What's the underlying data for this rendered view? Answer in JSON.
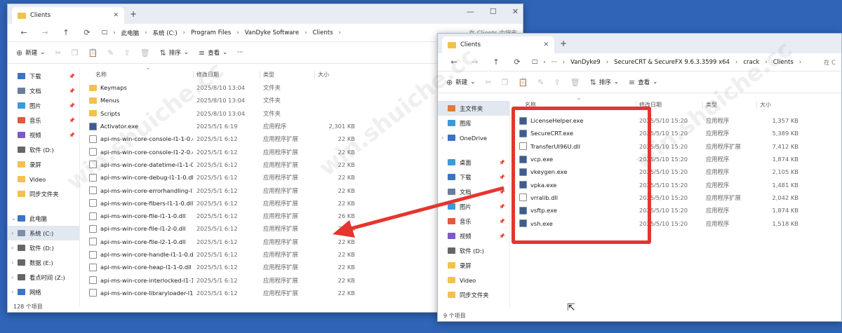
{
  "watermark": "win.shuiche.cc",
  "colors": {
    "accent": "#2f64b7",
    "highlight": "#e5352e",
    "folder": "#f2c14e"
  },
  "win_a": {
    "tab_title": "Clients",
    "nav": [
      "←",
      "→",
      "↑",
      "⟳"
    ],
    "breadcrumb": [
      "此电脑",
      "系统 (C:)",
      "Program Files",
      "VanDyke Software",
      "Clients"
    ],
    "search": "在 Clients 中搜索",
    "toolbar": {
      "new": "新建",
      "sort": "排序",
      "view": "查看",
      "more": "···"
    },
    "sidebar": [
      {
        "label": "下载",
        "color": "#3b73c5",
        "pin": true
      },
      {
        "label": "文档",
        "color": "#6b7f9c",
        "pin": true
      },
      {
        "label": "图片",
        "color": "#3b9ad8",
        "pin": true
      },
      {
        "label": "音乐",
        "color": "#e25a3c",
        "pin": true
      },
      {
        "label": "视频",
        "color": "#7b5bc7",
        "pin": true
      },
      {
        "label": "软件 (D:)",
        "color": "#666666",
        "pin": false
      },
      {
        "label": "录屏",
        "color": "#f2c14e",
        "pin": false
      },
      {
        "label": "Video",
        "color": "#f2c14e",
        "pin": false
      },
      {
        "label": "同步文件夹",
        "color": "#f2c14e",
        "pin": false
      },
      {
        "label": "",
        "color": "",
        "pin": false
      },
      {
        "label": "此电脑",
        "color": "#3b73c5",
        "pin": false,
        "chev": "⌄"
      },
      {
        "label": "系统 (C:)",
        "color": "#7d8ea8",
        "pin": false,
        "chev": "›",
        "sel": true
      },
      {
        "label": "软件 (D:)",
        "color": "#666666",
        "pin": false,
        "chev": "›"
      },
      {
        "label": "数据 (E:)",
        "color": "#666666",
        "pin": false,
        "chev": "›"
      },
      {
        "label": "看点时间 (Z:)",
        "color": "#666666",
        "pin": false,
        "chev": "›"
      },
      {
        "label": "网络",
        "color": "#3b73c5",
        "pin": false,
        "chev": "›"
      }
    ],
    "headers": [
      "名称",
      "修改日期",
      "类型",
      "大小"
    ],
    "rows": [
      {
        "icon": "folder",
        "name": "Keymaps",
        "date": "2025/8/10 13:04",
        "type": "文件夹",
        "size": ""
      },
      {
        "icon": "folder",
        "name": "Menus",
        "date": "2025/8/10 13:04",
        "type": "文件夹",
        "size": ""
      },
      {
        "icon": "folder",
        "name": "Scripts",
        "date": "2025/8/10 13:04",
        "type": "文件夹",
        "size": ""
      },
      {
        "icon": "exe",
        "name": "Activator.exe",
        "date": "2025/5/1 6:19",
        "type": "应用程序",
        "size": "2,301 KB"
      },
      {
        "icon": "dll",
        "name": "api-ms-win-core-console-l1-1-0.dll",
        "date": "2025/5/1 6:12",
        "type": "应用程序扩展",
        "size": "22 KB"
      },
      {
        "icon": "dll",
        "name": "api-ms-win-core-console-l1-2-0.dll",
        "date": "2025/5/1 6:12",
        "type": "应用程序扩展",
        "size": "22 KB"
      },
      {
        "icon": "dll",
        "name": "api-ms-win-core-datetime-l1-1-0.dll",
        "date": "2025/5/1 6:12",
        "type": "应用程序扩展",
        "size": "22 KB"
      },
      {
        "icon": "dll",
        "name": "api-ms-win-core-debug-l1-1-0.dll",
        "date": "2025/5/1 6:12",
        "type": "应用程序扩展",
        "size": "22 KB"
      },
      {
        "icon": "dll",
        "name": "api-ms-win-core-errorhandling-l1-1-...",
        "date": "2025/5/1 6:12",
        "type": "应用程序扩展",
        "size": "22 KB"
      },
      {
        "icon": "dll",
        "name": "api-ms-win-core-fibers-l1-1-0.dll",
        "date": "2025/5/1 6:12",
        "type": "应用程序扩展",
        "size": "22 KB"
      },
      {
        "icon": "dll",
        "name": "api-ms-win-core-file-l1-1-0.dll",
        "date": "2025/5/1 6:12",
        "type": "应用程序扩展",
        "size": "26 KB"
      },
      {
        "icon": "dll",
        "name": "api-ms-win-core-file-l1-2-0.dll",
        "date": "2025/5/1 6:12",
        "type": "应用程序扩展",
        "size": "22 KB"
      },
      {
        "icon": "dll",
        "name": "api-ms-win-core-file-l2-1-0.dll",
        "date": "2025/5/1 6:12",
        "type": "应用程序扩展",
        "size": "22 KB"
      },
      {
        "icon": "dll",
        "name": "api-ms-win-core-handle-l1-1-0.dll",
        "date": "2025/5/1 6:12",
        "type": "应用程序扩展",
        "size": "22 KB"
      },
      {
        "icon": "dll",
        "name": "api-ms-win-core-heap-l1-1-0.dll",
        "date": "2025/5/1 6:12",
        "type": "应用程序扩展",
        "size": "22 KB"
      },
      {
        "icon": "dll",
        "name": "api-ms-win-core-interlocked-l1-1-0.dll",
        "date": "2025/5/1 6:12",
        "type": "应用程序扩展",
        "size": "22 KB"
      },
      {
        "icon": "dll",
        "name": "api-ms-win-core-libraryloader-l1-1-...",
        "date": "2025/5/1 6:12",
        "type": "应用程序扩展",
        "size": "22 KB"
      }
    ],
    "status": "128 个项目"
  },
  "win_b": {
    "tab_title": "Clients",
    "nav": [
      "←",
      "→",
      "↑",
      "⟳"
    ],
    "breadcrumb": [
      "···",
      "VanDyke9",
      "SecureCRT & SecureFX 9.6.3.3599 x64",
      "crack",
      "Clients"
    ],
    "search": "在 C",
    "toolbar": {
      "new": "新建",
      "sort": "排序",
      "view": "查看"
    },
    "sidebar": [
      {
        "label": "主文件夹",
        "color": "#e07b39",
        "pin": false,
        "sel": true
      },
      {
        "label": "图库",
        "color": "#3b9ad8",
        "pin": false
      },
      {
        "label": "OneDrive",
        "color": "#3b73c5",
        "pin": false,
        "chev": "›"
      },
      {
        "label": "",
        "color": "",
        "pin": false
      },
      {
        "label": "桌面",
        "color": "#3b9ad8",
        "pin": true
      },
      {
        "label": "下载",
        "color": "#3b73c5",
        "pin": true
      },
      {
        "label": "文档",
        "color": "#6b7f9c",
        "pin": true
      },
      {
        "label": "图片",
        "color": "#3b9ad8",
        "pin": true
      },
      {
        "label": "音乐",
        "color": "#e25a3c",
        "pin": true
      },
      {
        "label": "视频",
        "color": "#7b5bc7",
        "pin": true
      },
      {
        "label": "软件 (D:)",
        "color": "#666666",
        "pin": false
      },
      {
        "label": "录屏",
        "color": "#f2c14e",
        "pin": false
      },
      {
        "label": "Video",
        "color": "#f2c14e",
        "pin": false
      },
      {
        "label": "同步文件夹",
        "color": "#f2c14e",
        "pin": false
      }
    ],
    "headers": [
      "名称",
      "修改日期",
      "类型",
      "大小"
    ],
    "rows": [
      {
        "icon": "exe",
        "name": "LicenseHelper.exe",
        "date": "2025/5/10 15:20",
        "type": "应用程序",
        "size": "1,357 KB"
      },
      {
        "icon": "exe",
        "name": "SecureCRT.exe",
        "date": "2025/5/10 15:20",
        "type": "应用程序",
        "size": "5,389 KB"
      },
      {
        "icon": "dll",
        "name": "TransferUI96U.dll",
        "date": "2025/5/10 15:20",
        "type": "应用程序扩展",
        "size": "7,412 KB"
      },
      {
        "icon": "exe",
        "name": "vcp.exe",
        "date": "2025/5/10 15:20",
        "type": "应用程序",
        "size": "1,874 KB"
      },
      {
        "icon": "exe",
        "name": "vkeygen.exe",
        "date": "2025/5/10 15:20",
        "type": "应用程序",
        "size": "2,105 KB"
      },
      {
        "icon": "exe",
        "name": "vpka.exe",
        "date": "2025/5/10 15:20",
        "type": "应用程序",
        "size": "1,481 KB"
      },
      {
        "icon": "dll",
        "name": "vrralib.dll",
        "date": "2025/5/10 15:20",
        "type": "应用程序扩展",
        "size": "2,042 KB"
      },
      {
        "icon": "exe",
        "name": "vsftp.exe",
        "date": "2025/5/10 15:20",
        "type": "应用程序",
        "size": "1,874 KB"
      },
      {
        "icon": "exe",
        "name": "vsh.exe",
        "date": "2025/5/10 15:20",
        "type": "应用程序",
        "size": "1,518 KB"
      }
    ],
    "status": "9 个项目"
  }
}
